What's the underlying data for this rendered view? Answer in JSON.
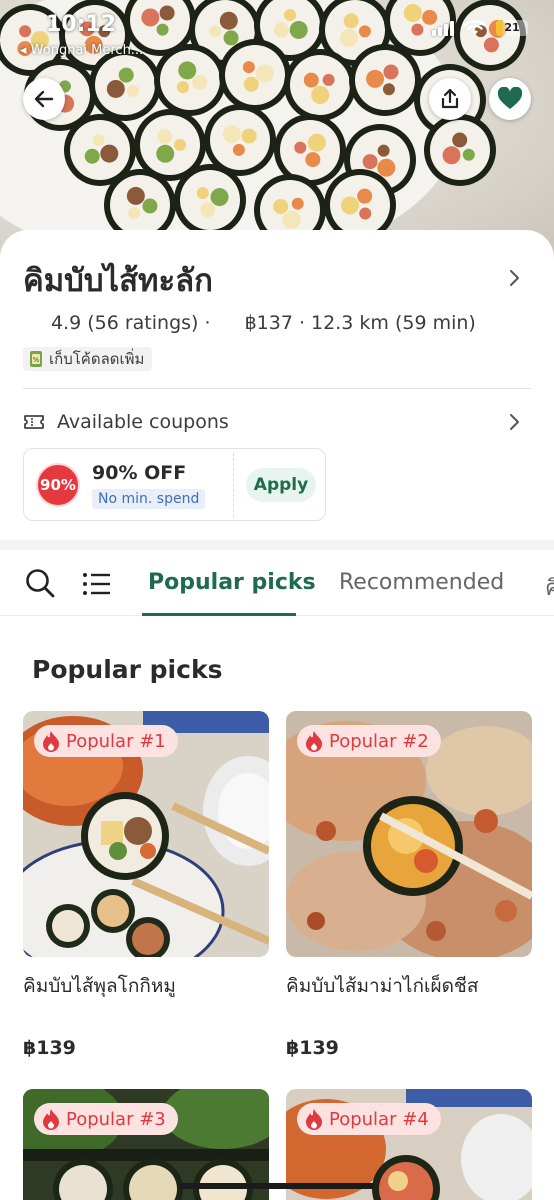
{
  "status_bar": {
    "time": "10:12",
    "back_app": "◂ Wongnai Merch...",
    "battery_level": "21"
  },
  "header": {
    "back_icon": "arrow-left-icon",
    "share_icon": "share-icon",
    "favorite_icon": "heart-icon"
  },
  "store": {
    "name": "คิมบับไส้ทะลัก",
    "rating": "4.9",
    "ratings_count": "(56 ratings) ·",
    "price_distance": "฿137 · 12.3 km (59 min)",
    "promo_chip": "เก็บโค้ดลดเพิ่ม"
  },
  "coupons": {
    "label": "Available coupons",
    "badge": "90%",
    "title": "90% OFF",
    "subtitle": "No min. spend",
    "apply_label": "Apply"
  },
  "tabs": {
    "items": [
      "Popular picks",
      "Recommended",
      "คิ"
    ],
    "active": "Popular picks"
  },
  "section": {
    "title": "Popular picks"
  },
  "items": [
    {
      "badge": "Popular #1",
      "name": "คิมบับไส้พุลโกกิหมู",
      "price": "฿139"
    },
    {
      "badge": "Popular #2",
      "name": "คิมบับไส้มาม่าไก่เผ็ดชีส",
      "price": "฿139"
    },
    {
      "badge": "Popular #3",
      "name": "",
      "price": ""
    },
    {
      "badge": "Popular #4",
      "name": "",
      "price": ""
    }
  ],
  "colors": {
    "brand_green": "#1e6b4f",
    "popular_red": "#e0393f",
    "coupon_red": "#e5393f",
    "favorite_green": "#1e6b4f"
  }
}
